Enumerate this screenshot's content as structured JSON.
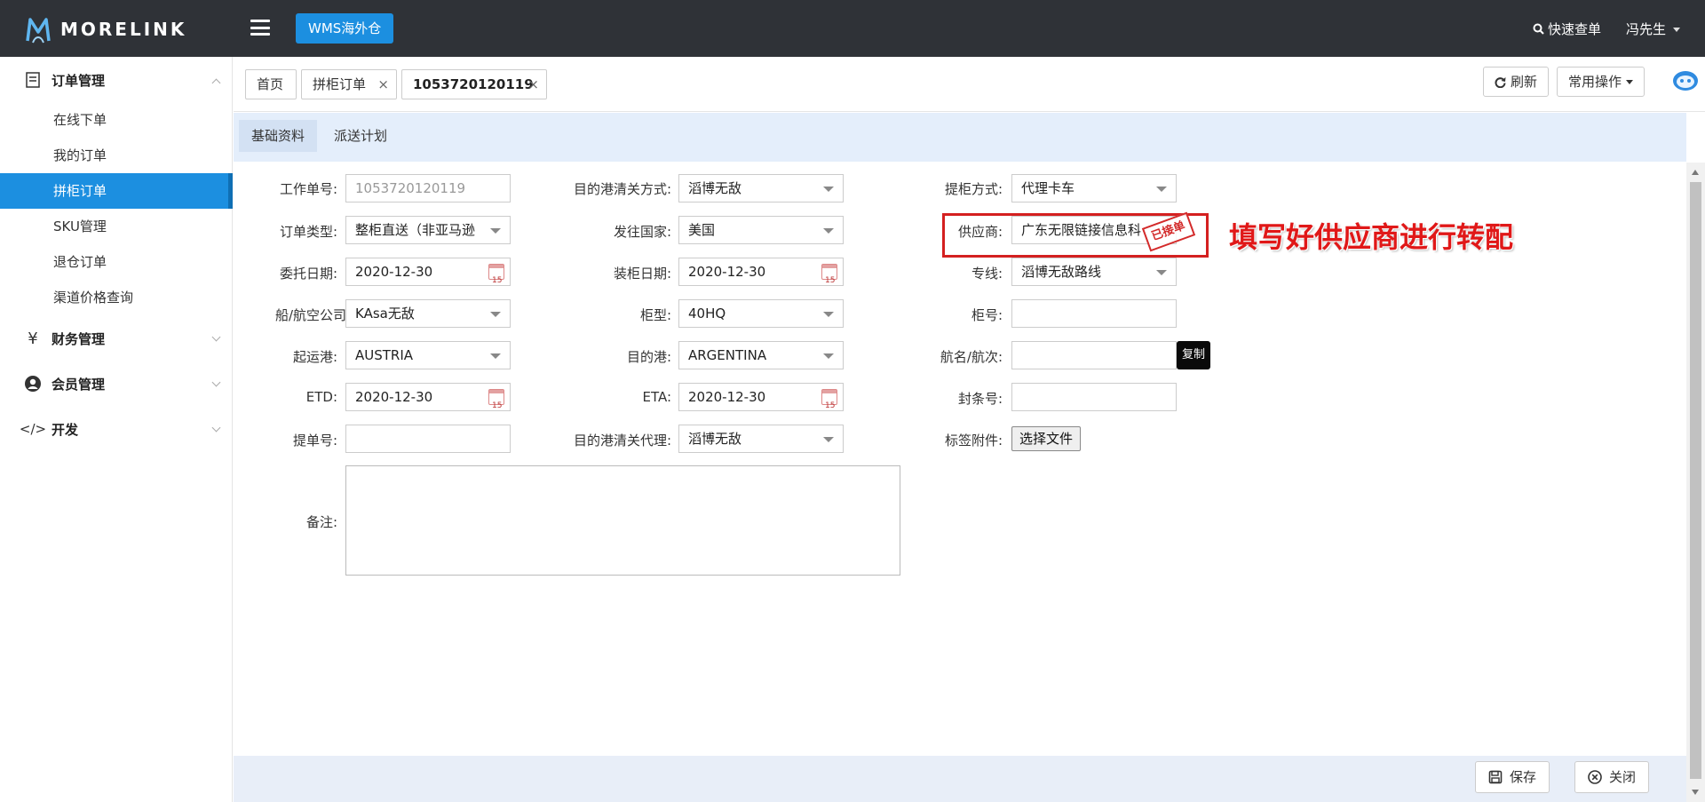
{
  "header": {
    "brand": "MORELINK",
    "wms_button": "WMS海外仓",
    "quick_search": "快速查单",
    "user_name": "冯先生"
  },
  "sidebar": {
    "sections": [
      {
        "label": "订单管理",
        "icon": "order-list-icon",
        "expanded": true
      },
      {
        "label": "财务管理",
        "icon": "yen-icon",
        "expanded": false
      },
      {
        "label": "会员管理",
        "icon": "user-icon",
        "expanded": false
      },
      {
        "label": "开发",
        "icon": "code-icon",
        "expanded": false
      }
    ],
    "sub_items": [
      "在线下单",
      "我的订单",
      "拼柜订单",
      "SKU管理",
      "退仓订单",
      "渠道价格查询"
    ],
    "active_item": "拼柜订单"
  },
  "tabs": {
    "home": "首页",
    "lcl": "拼柜订单",
    "order": "1053720120119",
    "refresh": "刷新",
    "common_ops": "常用操作"
  },
  "subtabs": [
    "基础资料",
    "派送计划"
  ],
  "form": {
    "col1": {
      "work_no_label": "工作单号:",
      "work_no_value": "1053720120119",
      "order_type_label": "订单类型:",
      "order_type_value": "整柜直送（非亚马逊",
      "entrust_date_label": "委托日期:",
      "entrust_date_value": "2020-12-30",
      "carrier_label": "船/航空公司",
      "carrier_value": "KAsa无敌",
      "pol_label": "起运港:",
      "pol_value": "AUSTRIA",
      "etd_label": "ETD:",
      "etd_value": "2020-12-30",
      "bl_label": "提单号:",
      "bl_value": "",
      "remark_label": "备注:"
    },
    "col2": {
      "clearance_label": "目的港清关方式:",
      "clearance_value": "滔博无敌",
      "country_label": "发往国家:",
      "country_value": "美国",
      "load_date_label": "装柜日期:",
      "load_date_value": "2020-12-30",
      "container_type_label": "柜型:",
      "container_type_value": "40HQ",
      "pod_label": "目的港:",
      "pod_value": "ARGENTINA",
      "eta_label": "ETA:",
      "eta_value": "2020-12-30",
      "agent_label": "目的港清关代理:",
      "agent_value": "滔博无敌"
    },
    "col3": {
      "pickup_label": "提柜方式:",
      "pickup_value": "代理卡车",
      "supplier_label": "供应商:",
      "supplier_value": "广东无限链接信息科",
      "line_label": "专线:",
      "line_value": "滔博无敌路线",
      "container_no_label": "柜号:",
      "container_no_value": "",
      "voyage_label": "航名/航次:",
      "voyage_value": "",
      "copy_label": "复制",
      "seal_label": "封条号:",
      "seal_value": "",
      "attach_label": "标签附件:",
      "attach_button": "选择文件"
    }
  },
  "annotation": {
    "stamp": "已接单",
    "text": "填写好供应商进行转配"
  },
  "footer": {
    "save": "保存",
    "close": "关闭"
  },
  "colors": {
    "topbar": "#2f3237",
    "accent": "#1c8fe0",
    "annotation_red": "#e01818"
  }
}
